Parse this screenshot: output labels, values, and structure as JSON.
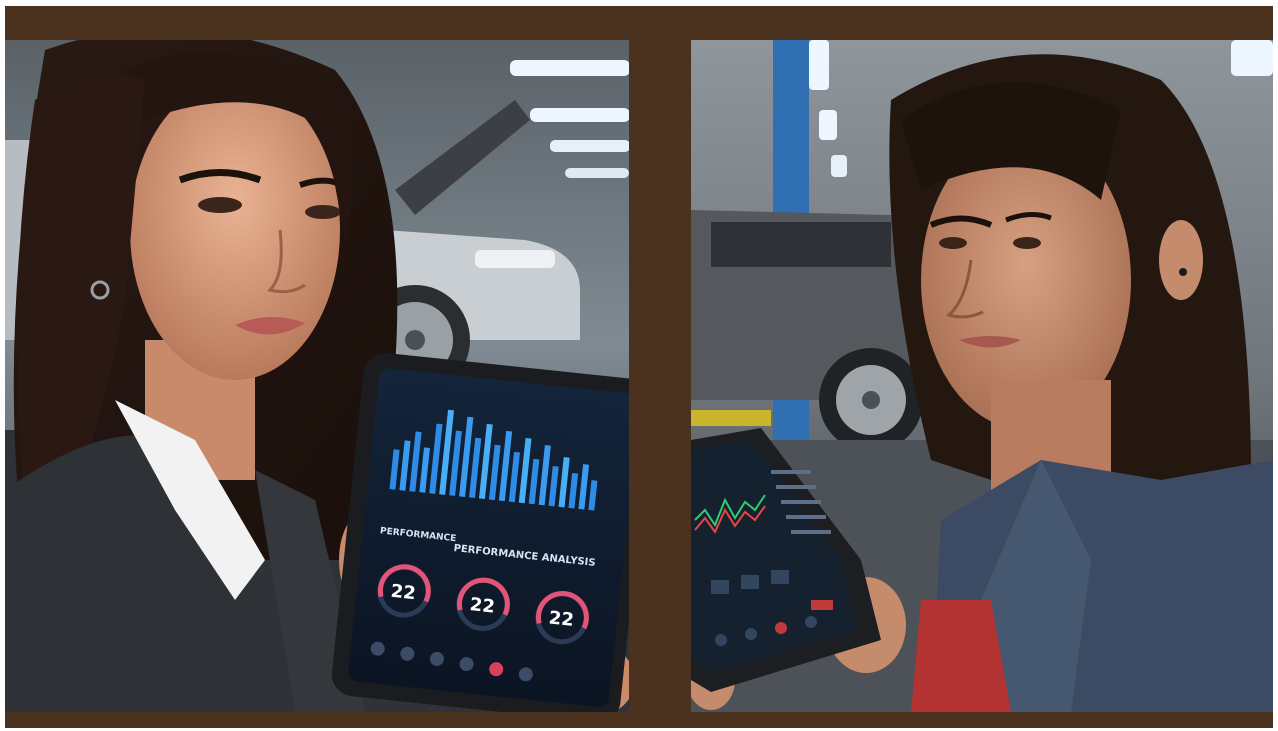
{
  "image": {
    "left_panel": {
      "tablet": {
        "header": "PERFORMANCE",
        "subheader": "PERFORMANCE ANALYSIS",
        "gauges": [
          "22",
          "22",
          "22"
        ]
      }
    },
    "right_panel": {
      "tablet": {}
    }
  },
  "colors": {
    "frame": "#4a321f",
    "bars": "#2e8ce6",
    "gauge_arc": "#e25478"
  }
}
